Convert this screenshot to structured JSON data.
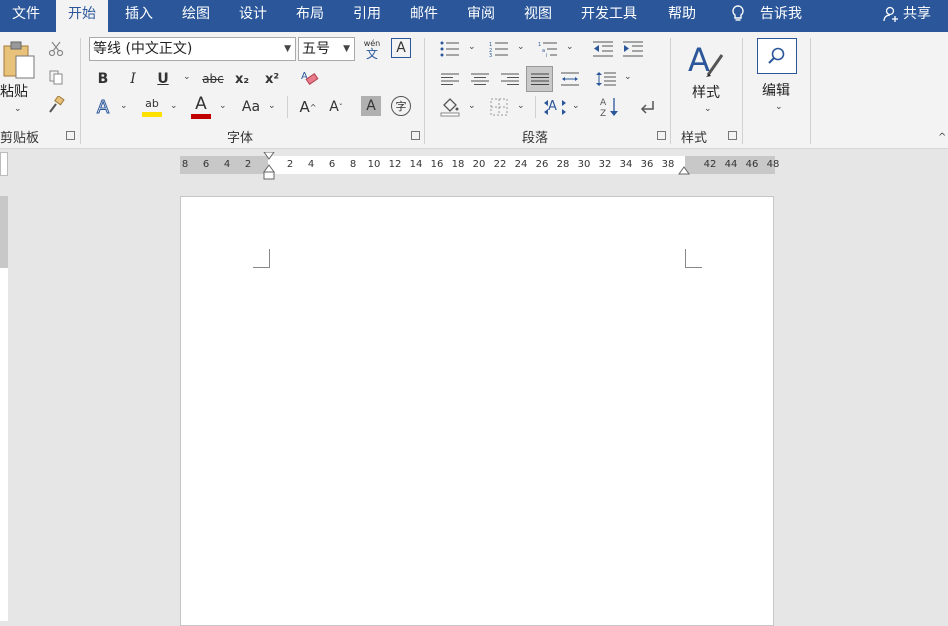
{
  "tabs": [
    {
      "label": "文件"
    },
    {
      "label": "开始"
    },
    {
      "label": "插入"
    },
    {
      "label": "绘图"
    },
    {
      "label": "设计"
    },
    {
      "label": "布局"
    },
    {
      "label": "引用"
    },
    {
      "label": "邮件"
    },
    {
      "label": "审阅"
    },
    {
      "label": "视图"
    },
    {
      "label": "开发工具"
    },
    {
      "label": "帮助"
    }
  ],
  "tell_me": "告诉我",
  "share": "共享",
  "clipboard": {
    "paste_label": "粘贴",
    "group_label": "剪贴板"
  },
  "font": {
    "name": "等线 (中文正文)",
    "size": "五号",
    "group_label": "字体",
    "bold": "B",
    "italic": "I",
    "underline": "U",
    "strike": "abc",
    "subscript": "x₂",
    "superscript": "x²",
    "phonetic_top": "wén",
    "phonetic_bottom": "文",
    "border_char": "A",
    "text_effects": "A",
    "highlight": "ab",
    "font_color": "A",
    "change_case": "Aa",
    "grow": "A",
    "shrink": "A",
    "shading": "A",
    "enclose": "字"
  },
  "paragraph": {
    "group_label": "段落"
  },
  "styles": {
    "label": "样式",
    "group_label": "样式"
  },
  "editing": {
    "label": "编辑"
  },
  "ruler": {
    "left_ticks": [
      "8",
      "6",
      "4",
      "2"
    ],
    "right_ticks": [
      "2",
      "4",
      "6",
      "8",
      "10",
      "12",
      "14",
      "16",
      "18",
      "20",
      "22",
      "24",
      "26",
      "28",
      "30",
      "32",
      "34",
      "36",
      "38",
      "42",
      "44",
      "46",
      "48"
    ]
  }
}
